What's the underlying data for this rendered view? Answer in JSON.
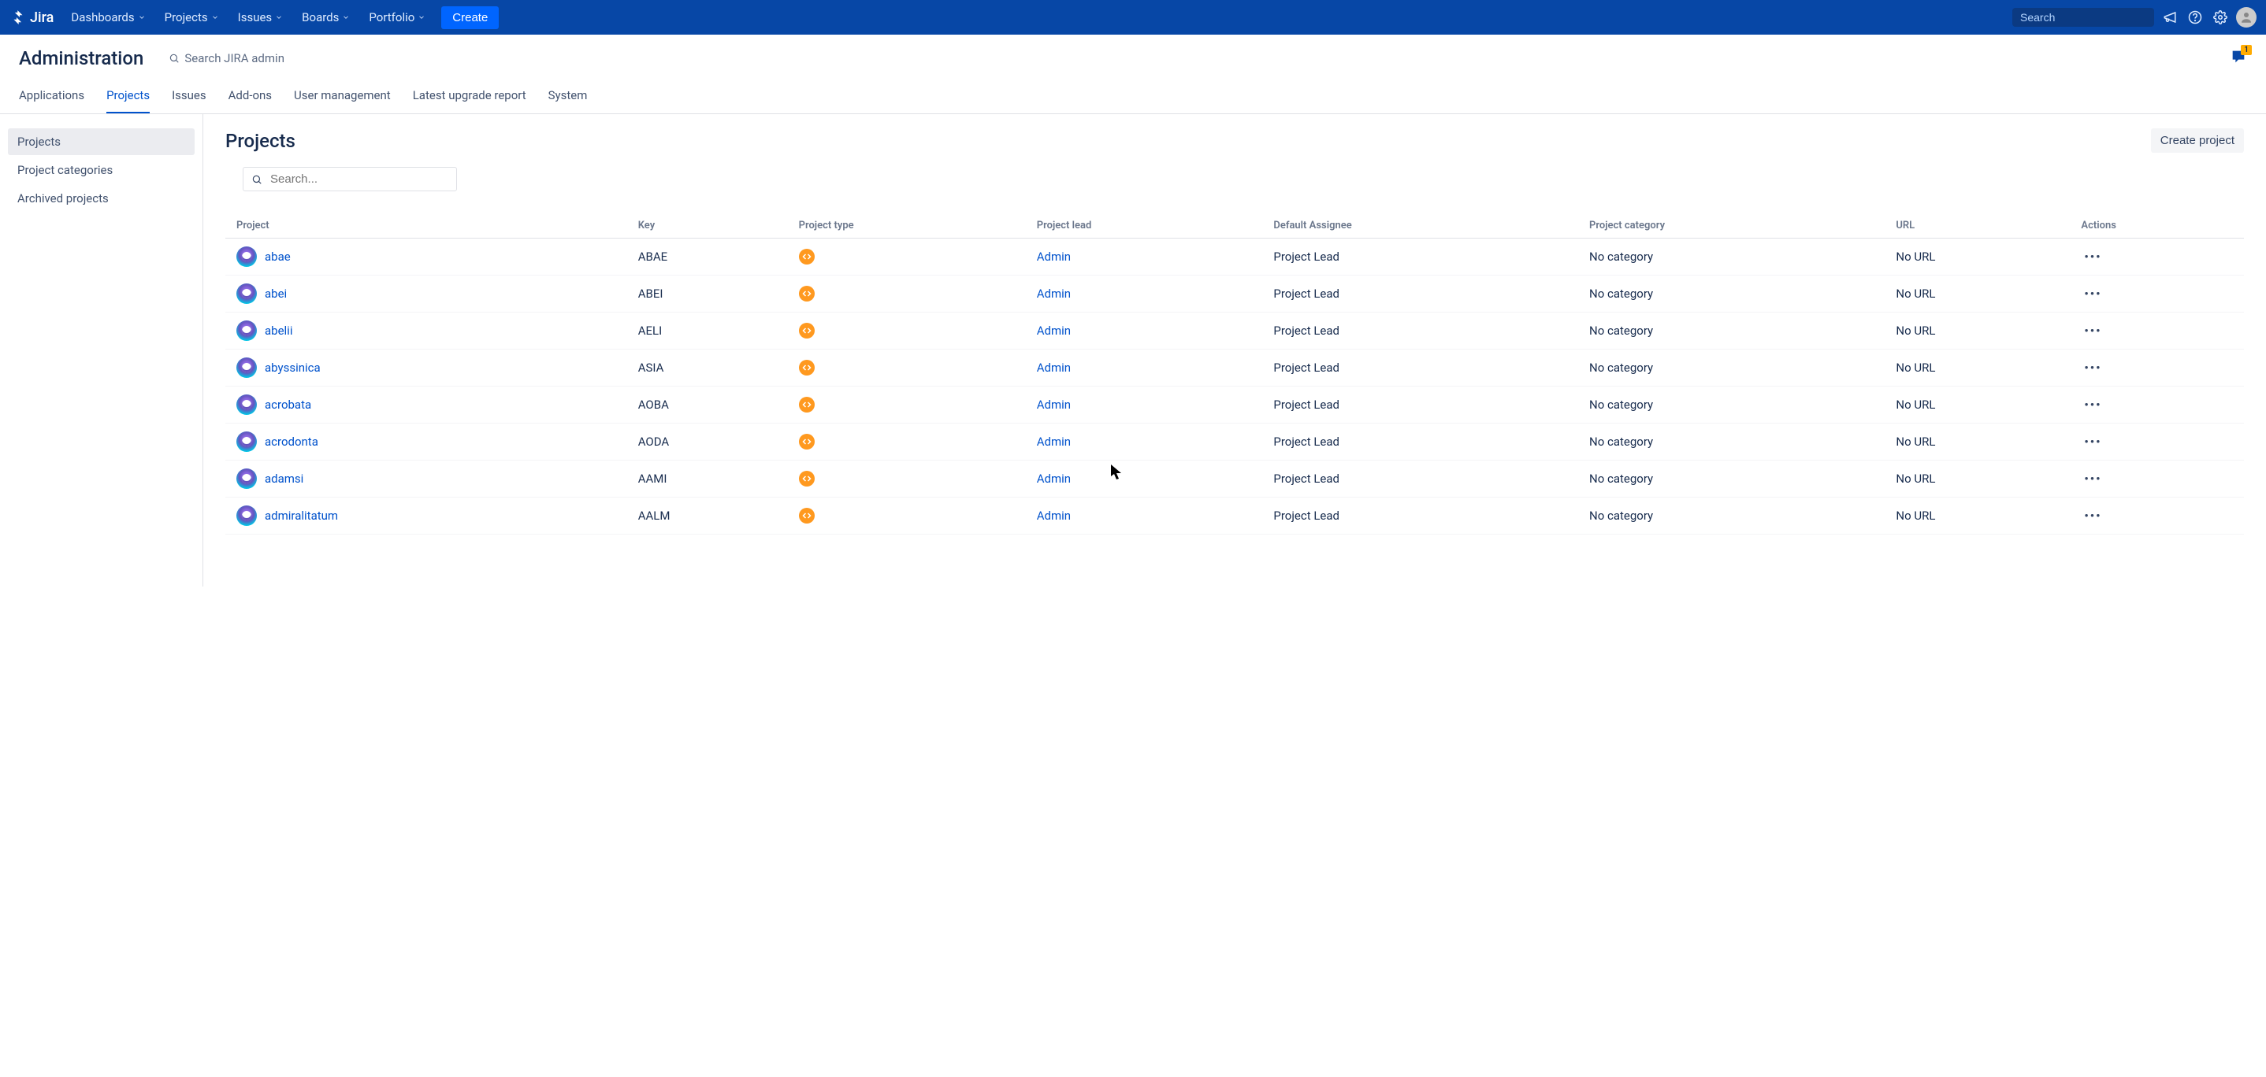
{
  "brand": "Jira",
  "topnav": {
    "items": [
      "Dashboards",
      "Projects",
      "Issues",
      "Boards",
      "Portfolio"
    ],
    "create": "Create",
    "search_placeholder": "Search"
  },
  "admin": {
    "title": "Administration",
    "search_placeholder": "Search JIRA admin",
    "feedback_badge": "1"
  },
  "tabs": [
    {
      "label": "Applications",
      "active": false
    },
    {
      "label": "Projects",
      "active": true
    },
    {
      "label": "Issues",
      "active": false
    },
    {
      "label": "Add-ons",
      "active": false
    },
    {
      "label": "User management",
      "active": false
    },
    {
      "label": "Latest upgrade report",
      "active": false
    },
    {
      "label": "System",
      "active": false
    }
  ],
  "sidebar": [
    {
      "label": "Projects",
      "active": true
    },
    {
      "label": "Project categories",
      "active": false
    },
    {
      "label": "Archived projects",
      "active": false
    }
  ],
  "page": {
    "title": "Projects",
    "create_button": "Create project",
    "table_search_placeholder": "Search..."
  },
  "columns": [
    "Project",
    "Key",
    "Project type",
    "Project lead",
    "Default Assignee",
    "Project category",
    "URL",
    "Actions"
  ],
  "rows": [
    {
      "name": "abae",
      "key": "ABAE",
      "lead": "Admin",
      "assignee": "Project Lead",
      "category": "No category",
      "url": "No URL"
    },
    {
      "name": "abei",
      "key": "ABEI",
      "lead": "Admin",
      "assignee": "Project Lead",
      "category": "No category",
      "url": "No URL"
    },
    {
      "name": "abelii",
      "key": "AELI",
      "lead": "Admin",
      "assignee": "Project Lead",
      "category": "No category",
      "url": "No URL"
    },
    {
      "name": "abyssinica",
      "key": "ASIA",
      "lead": "Admin",
      "assignee": "Project Lead",
      "category": "No category",
      "url": "No URL"
    },
    {
      "name": "acrobata",
      "key": "AOBA",
      "lead": "Admin",
      "assignee": "Project Lead",
      "category": "No category",
      "url": "No URL"
    },
    {
      "name": "acrodonta",
      "key": "AODA",
      "lead": "Admin",
      "assignee": "Project Lead",
      "category": "No category",
      "url": "No URL"
    },
    {
      "name": "adamsi",
      "key": "AAMI",
      "lead": "Admin",
      "assignee": "Project Lead",
      "category": "No category",
      "url": "No URL"
    },
    {
      "name": "admiralitatum",
      "key": "AALM",
      "lead": "Admin",
      "assignee": "Project Lead",
      "category": "No category",
      "url": "No URL"
    }
  ]
}
